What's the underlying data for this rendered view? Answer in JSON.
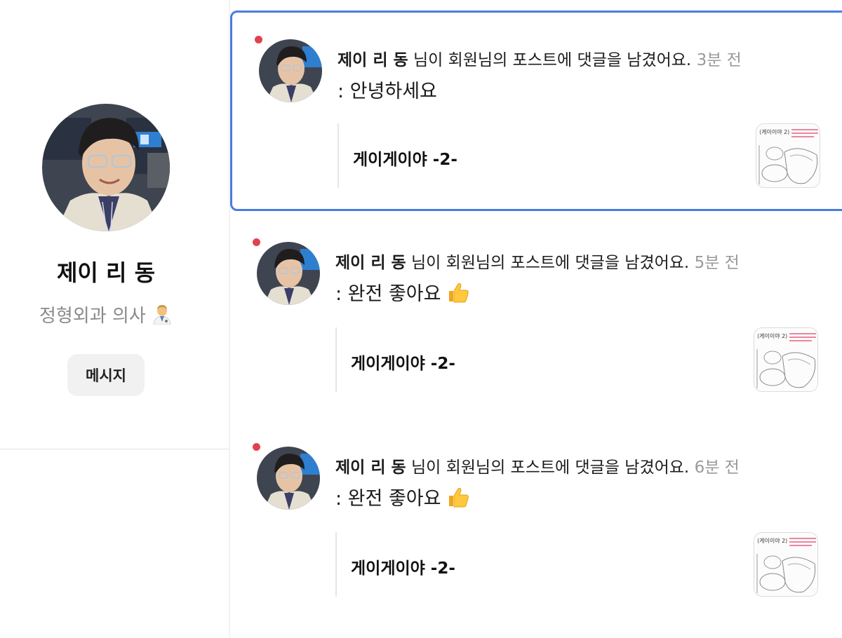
{
  "profile": {
    "name": "제이 리 동",
    "bio": "정형외과 의사",
    "bio_emoji_icon": "doctor-emoji-icon",
    "message_button": "메시지"
  },
  "notifications": [
    {
      "actor": "제이 리 동",
      "action": " 님이 회원님의 포스트에 댓글을 남겼어요. ",
      "time": "3분 전",
      "comment": ": 안녕하세요",
      "has_thumbs_up": false,
      "post_title": "게이게이야 -2-",
      "unread": true,
      "selected": true
    },
    {
      "actor": "제이 리 동",
      "action": " 님이 회원님의 포스트에 댓글을 남겼어요. ",
      "time": "5분 전",
      "comment": ": 완전 좋아요",
      "has_thumbs_up": true,
      "post_title": "게이게이야 -2-",
      "unread": true,
      "selected": false
    },
    {
      "actor": "제이 리 동",
      "action": " 님이 회원님의 포스트에 댓글을 남겼어요. ",
      "time": "6분 전",
      "comment": ": 완전 좋아요",
      "has_thumbs_up": true,
      "post_title": "게이게이야 -2-",
      "unread": true,
      "selected": false
    }
  ],
  "colors": {
    "selected_border": "#4a7be0",
    "unread_dot": "#e0434f",
    "muted_text": "#9a9a9a"
  }
}
